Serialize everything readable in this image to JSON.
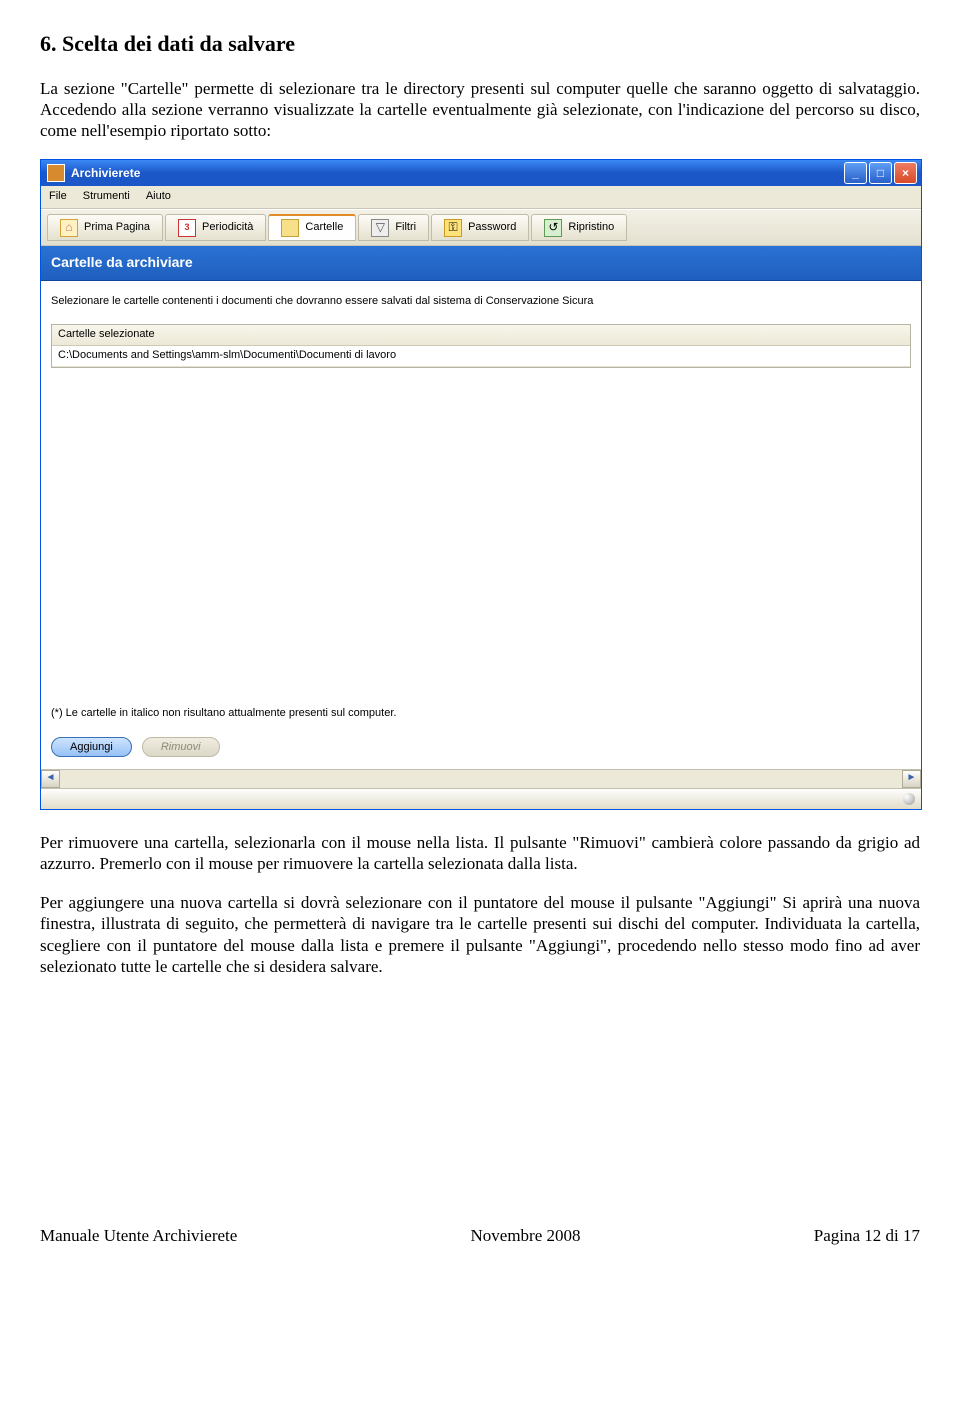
{
  "doc": {
    "heading": "6. Scelta dei dati da salvare",
    "para1": "La sezione \"Cartelle\" permette di selezionare tra le directory presenti sul computer quelle che saranno oggetto di salvataggio. Accedendo alla sezione verranno visualizzate la cartelle eventualmente già selezionate, con l'indicazione del percorso su disco, come nell'esempio riportato sotto:",
    "para2": "Per rimuovere una cartella, selezionarla con il mouse nella lista. Il pulsante \"Rimuovi\" cambierà colore passando da grigio ad azzurro. Premerlo con il mouse per rimuovere la cartella selezionata dalla lista.",
    "para3": "Per aggiungere una nuova cartella si dovrà selezionare con il puntatore del mouse il pulsante \"Aggiungi\" Si aprirà una nuova finestra, illustrata di seguito, che permetterà di navigare tra le cartelle presenti sui dischi del computer. Individuata la cartella, scegliere con il puntatore del mouse dalla lista e premere il pulsante \"Aggiungi\", procedendo nello stesso modo fino ad aver selezionato tutte le cartelle che si desidera salvare."
  },
  "window": {
    "title": "Archivierete",
    "menus": [
      "File",
      "Strumenti",
      "Aiuto"
    ],
    "tabs": [
      {
        "label": "Prima Pagina",
        "icon": "home"
      },
      {
        "label": "Periodicità",
        "icon": "calendar"
      },
      {
        "label": "Cartelle",
        "icon": "folder",
        "active": true
      },
      {
        "label": "Filtri",
        "icon": "filter"
      },
      {
        "label": "Password",
        "icon": "key"
      },
      {
        "label": "Ripristino",
        "icon": "ripristino"
      }
    ],
    "section_title": "Cartelle da archiviare",
    "instruction": "Selezionare le cartelle contenenti i documenti che dovranno essere salvati dal sistema di Conservazione Sicura",
    "list_header": "Cartelle selezionate",
    "list_rows": [
      "C:\\Documents and Settings\\amm-slm\\Documenti\\Documenti di lavoro"
    ],
    "note": "(*) Le cartelle in italico non risultano attualmente presenti sul computer.",
    "btn_add": "Aggiungi",
    "btn_remove": "Rimuovi"
  },
  "footer": {
    "left": "Manuale Utente Archivierete",
    "center": "Novembre 2008",
    "right": "Pagina 12 di 17"
  }
}
